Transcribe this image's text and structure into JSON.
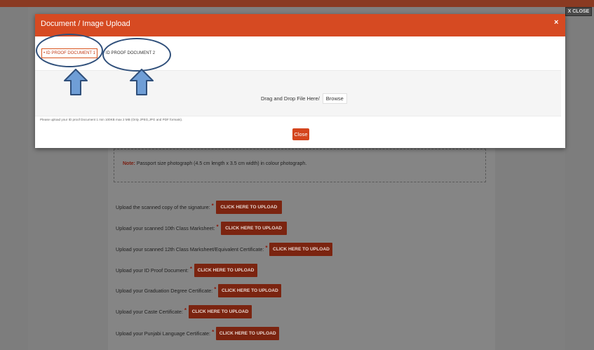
{
  "background": {
    "close_label": "X CLOSE",
    "note": {
      "label": "Note:",
      "text": "Passport size photograph (4.5 cm length x 3.5 cm width) in colour photograph."
    },
    "upload_button_label": "CLICK HERE TO UPLOAD",
    "required_mark": "*",
    "upload_items": [
      {
        "label": "Upload the scanned copy of the signature:"
      },
      {
        "label": "Upload your scanned 10th Class Marksheet:"
      },
      {
        "label": "Upload your scanned 12th Class Marksheet/Equivalent Certificate:"
      },
      {
        "label": "Upload your ID Proof Document:"
      },
      {
        "label": "Upload your Graduation Degree Certificate:"
      },
      {
        "label": "Upload your Caste Certificate:"
      },
      {
        "label": "Upload your Punjabi Language Certificate:"
      }
    ]
  },
  "modal": {
    "title": "Document / Image Upload",
    "close_x": "×",
    "tabs": [
      {
        "label": "• ID PROOF DOCUMENT 1",
        "active": true
      },
      {
        "label": "ID PROOF DOCUMENT 2",
        "active": false
      }
    ],
    "dropzone": {
      "text": "Drag and Drop File Here/",
      "browse_label": "Browse"
    },
    "help_text": "Please upload your ID proof Document 1 min 100KB max 2 MB (Only JPEG,JPG and PDF formats).",
    "close_label": "Close"
  },
  "colors": {
    "modal_header": "#d64a22",
    "upload_button": "#7b2410",
    "annotation": "#2f4f7a",
    "arrow_fill": "#6f9ed6"
  }
}
